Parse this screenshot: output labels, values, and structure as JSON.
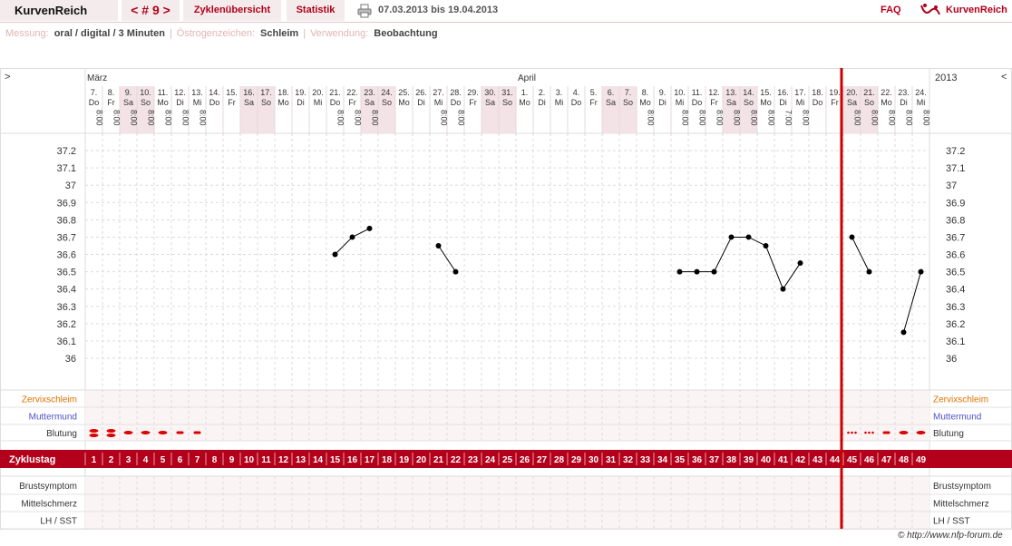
{
  "header": {
    "app_title": "KurvenReich",
    "cycle_nav": "< # 9 >",
    "tab_overview": "Zyklenübersicht",
    "tab_stats": "Statistik",
    "date_range": "07.03.2013 bis 19.04.2013",
    "faq": "FAQ",
    "logo_text": "KurvenReich"
  },
  "info": {
    "measurement_label": "Messung:",
    "measurement_value": "oral / digital / 3 Minuten",
    "estrogen_label": "Östrogenzeichen:",
    "estrogen_value": "Schleim",
    "usage_label": "Verwendung:",
    "usage_value": "Beobachtung"
  },
  "colors": {
    "accent": "#b3001b",
    "weekend": "#f3e3e7",
    "row_bg": "#fbf4f4",
    "cervix_label": "#e07000",
    "os_label": "#5050c8"
  },
  "chart_data": {
    "type": "line",
    "nav_left": ">",
    "nav_right": "<",
    "year": "2013",
    "months": [
      {
        "label": "März",
        "start_index": 0
      },
      {
        "label": "April",
        "start_index": 25
      }
    ],
    "days": [
      {
        "d": "7.",
        "w": "Do",
        "t": "8:00",
        "we": false
      },
      {
        "d": "8.",
        "w": "Fr",
        "t": "8:00",
        "we": false
      },
      {
        "d": "9.",
        "w": "Sa",
        "t": "8:00",
        "we": true
      },
      {
        "d": "10.",
        "w": "So",
        "t": "8:00",
        "we": true
      },
      {
        "d": "11.",
        "w": "Mo",
        "t": "8:00",
        "we": false
      },
      {
        "d": "12.",
        "w": "Di",
        "t": "8:00",
        "we": false
      },
      {
        "d": "13.",
        "w": "Mi",
        "t": "8:00",
        "we": false
      },
      {
        "d": "14.",
        "w": "Do",
        "t": "",
        "we": false
      },
      {
        "d": "15.",
        "w": "Fr",
        "t": "",
        "we": false
      },
      {
        "d": "16.",
        "w": "Sa",
        "t": "",
        "we": true
      },
      {
        "d": "17.",
        "w": "So",
        "t": "",
        "we": true
      },
      {
        "d": "18.",
        "w": "Mo",
        "t": "",
        "we": false
      },
      {
        "d": "19.",
        "w": "Di",
        "t": "",
        "we": false
      },
      {
        "d": "20.",
        "w": "Mi",
        "t": "",
        "we": false
      },
      {
        "d": "21.",
        "w": "Do",
        "t": "8:00",
        "we": false
      },
      {
        "d": "22.",
        "w": "Fr",
        "t": "8:00",
        "we": false
      },
      {
        "d": "23.",
        "w": "Sa",
        "t": "8:00",
        "we": true
      },
      {
        "d": "24.",
        "w": "So",
        "t": "",
        "we": true
      },
      {
        "d": "25.",
        "w": "Mo",
        "t": "",
        "we": false
      },
      {
        "d": "26.",
        "w": "Di",
        "t": "",
        "we": false
      },
      {
        "d": "27.",
        "w": "Mi",
        "t": "8:00",
        "we": false
      },
      {
        "d": "28.",
        "w": "Do",
        "t": "8:00",
        "we": false
      },
      {
        "d": "29.",
        "w": "Fr",
        "t": "",
        "we": false
      },
      {
        "d": "30.",
        "w": "Sa",
        "t": "",
        "we": true
      },
      {
        "d": "31.",
        "w": "So",
        "t": "",
        "we": true
      },
      {
        "d": "1.",
        "w": "Mo",
        "t": "",
        "we": false
      },
      {
        "d": "2.",
        "w": "Di",
        "t": "",
        "we": false
      },
      {
        "d": "3.",
        "w": "Mi",
        "t": "",
        "we": false
      },
      {
        "d": "4.",
        "w": "Do",
        "t": "",
        "we": false
      },
      {
        "d": "5.",
        "w": "Fr",
        "t": "",
        "we": false
      },
      {
        "d": "6.",
        "w": "Sa",
        "t": "",
        "we": true
      },
      {
        "d": "7.",
        "w": "So",
        "t": "",
        "we": true
      },
      {
        "d": "8.",
        "w": "Mo",
        "t": "8:00",
        "we": false
      },
      {
        "d": "9.",
        "w": "Di",
        "t": "",
        "we": false
      },
      {
        "d": "10.",
        "w": "Mi",
        "t": "8:00",
        "we": false
      },
      {
        "d": "11.",
        "w": "Do",
        "t": "8:00",
        "we": false
      },
      {
        "d": "12.",
        "w": "Fr",
        "t": "8:00",
        "we": false
      },
      {
        "d": "13.",
        "w": "Sa",
        "t": "8:00",
        "we": true
      },
      {
        "d": "14.",
        "w": "So",
        "t": "8:00",
        "we": true
      },
      {
        "d": "15.",
        "w": "Mo",
        "t": "8:00",
        "we": false
      },
      {
        "d": "16.",
        "w": "Di",
        "t": "7:00",
        "we": false
      },
      {
        "d": "17.",
        "w": "Mi",
        "t": "8:00",
        "we": false
      },
      {
        "d": "18.",
        "w": "Do",
        "t": "",
        "we": false
      },
      {
        "d": "19.",
        "w": "Fr",
        "t": "",
        "we": false
      },
      {
        "d": "20.",
        "w": "Sa",
        "t": "8:00",
        "we": true
      },
      {
        "d": "21.",
        "w": "So",
        "t": "8:00",
        "we": true
      },
      {
        "d": "22.",
        "w": "Mo",
        "t": "8:00",
        "we": false
      },
      {
        "d": "23.",
        "w": "Di",
        "t": "8:00",
        "we": false
      },
      {
        "d": "24.",
        "w": "Mi",
        "t": "8:00",
        "we": false
      }
    ],
    "cycle_days": [
      1,
      2,
      3,
      4,
      5,
      6,
      7,
      8,
      9,
      10,
      11,
      12,
      13,
      14,
      15,
      16,
      17,
      18,
      19,
      20,
      21,
      22,
      23,
      24,
      25,
      26,
      27,
      28,
      29,
      30,
      31,
      32,
      33,
      34,
      35,
      36,
      37,
      38,
      39,
      40,
      41,
      42,
      43,
      44,
      45,
      46,
      47,
      48,
      49
    ],
    "current_cycle_day": 45,
    "y_ticks": [
      36,
      36.1,
      36.2,
      36.3,
      36.4,
      36.5,
      36.6,
      36.7,
      36.8,
      36.9,
      37,
      37.1,
      37.2
    ],
    "ylim": [
      36,
      37.2
    ],
    "grid": true,
    "temperatures": [
      [
        36.6,
        36.7,
        36.75
      ],
      [
        36.65,
        36.5
      ],
      [
        36.5,
        36.5,
        36.5,
        36.7,
        36.7,
        36.65,
        36.4,
        36.55
      ],
      [
        36.7,
        36.5
      ],
      [
        36.15,
        36.5
      ]
    ],
    "temperature_days": [
      [
        15,
        16,
        17
      ],
      [
        21,
        22
      ],
      [
        35,
        36,
        37,
        38,
        39,
        40,
        41,
        42
      ],
      [
        45,
        46
      ],
      [
        48,
        49
      ]
    ],
    "bleeding": [
      {
        "day": 1,
        "level": "heavy"
      },
      {
        "day": 2,
        "level": "heavy"
      },
      {
        "day": 3,
        "level": "medium"
      },
      {
        "day": 4,
        "level": "medium"
      },
      {
        "day": 5,
        "level": "medium"
      },
      {
        "day": 6,
        "level": "light"
      },
      {
        "day": 7,
        "level": "light"
      },
      {
        "day": 45,
        "level": "spotting"
      },
      {
        "day": 46,
        "level": "spotting"
      },
      {
        "day": 47,
        "level": "light"
      },
      {
        "day": 48,
        "level": "medium"
      },
      {
        "day": 49,
        "level": "medium"
      }
    ],
    "rows": {
      "cervix": "Zervixschleim",
      "os": "Muttermund",
      "bleeding": "Blutung",
      "cycle_day": "Zyklustag",
      "breast": "Brustsymptom",
      "midpain": "Mittelschmerz",
      "lh": "LH / SST"
    }
  },
  "footer": {
    "credit": "© http://www.nfp-forum.de"
  }
}
